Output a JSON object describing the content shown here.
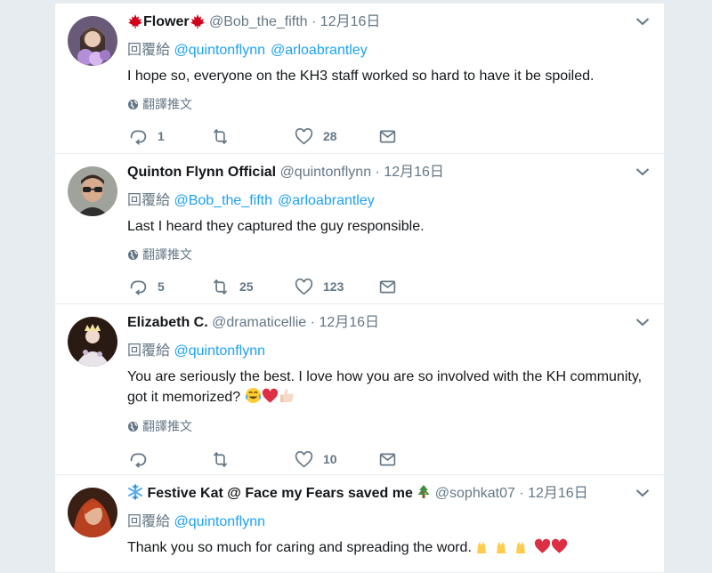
{
  "labels": {
    "reply_to_prefix": "回覆給",
    "translate": "翻譯推文"
  },
  "tweets": [
    {
      "name": "Flower",
      "name_flag_left": "🍁",
      "name_flag_right": "🍁",
      "handle": "@Bob_the_fifth",
      "time": "12月16日",
      "reply_mentions": [
        "@quintonflynn",
        "@arloabrantley"
      ],
      "text": "I hope so, everyone on the KH3 staff worked so hard to have it be spoiled.",
      "replies": "1",
      "retweets": "",
      "likes": "28"
    },
    {
      "name": "Quinton Flynn Official",
      "handle": "@quintonflynn",
      "time": "12月16日",
      "reply_mentions": [
        "@Bob_the_fifth",
        "@arloabrantley"
      ],
      "text": "Last I heard they captured the guy responsible.",
      "replies": "5",
      "retweets": "25",
      "likes": "123"
    },
    {
      "name": "Elizabeth C.",
      "handle": "@dramaticellie",
      "time": "12月16日",
      "reply_mentions": [
        "@quintonflynn"
      ],
      "text_line1": "You are seriously the best. I love how you are so involved with the KH community,",
      "text_line2": "got it memorized?",
      "replies": "",
      "retweets": "",
      "likes": "10"
    },
    {
      "name": "Festive Kat @ Face my Fears saved me",
      "handle": "@sophkat07",
      "time": "12月16日",
      "reply_mentions": [
        "@quintonflynn"
      ],
      "text": "Thank you so much for caring and spreading the word."
    }
  ],
  "colors": {
    "link": "#1da1f2",
    "secondary": "#657786",
    "heart": "#e0245e",
    "leaf": "#d0021b"
  }
}
